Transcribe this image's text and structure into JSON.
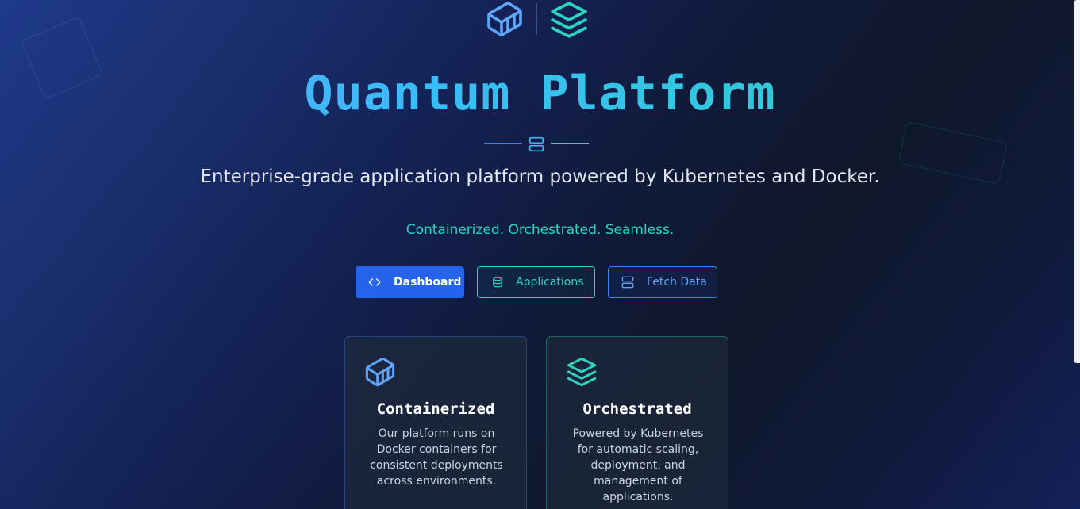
{
  "hero": {
    "title": "Quantum Platform",
    "subtitle": "Enterprise-grade application platform powered by Kubernetes and Docker.",
    "tagline": "Containerized. Orchestrated. Seamless."
  },
  "actions": {
    "dashboard_label": "Dashboard",
    "applications_label": "Applications",
    "fetch_label": "Fetch Data"
  },
  "features": [
    {
      "title": "Containerized",
      "description": "Our platform runs on Docker containers for consistent deployments across environments.",
      "icon": "container-icon"
    },
    {
      "title": "Orchestrated",
      "description": "Powered by Kubernetes for automatic scaling, deployment, and management of applications.",
      "icon": "layers-icon"
    }
  ],
  "colors": {
    "primary": "#3b82f6",
    "accent": "#2dd4bf",
    "background": "#0f172a",
    "button_primary": "#2563eb"
  },
  "icons": {
    "logo_left": "container-icon",
    "logo_right": "layers-icon",
    "divider": "server-icon"
  }
}
